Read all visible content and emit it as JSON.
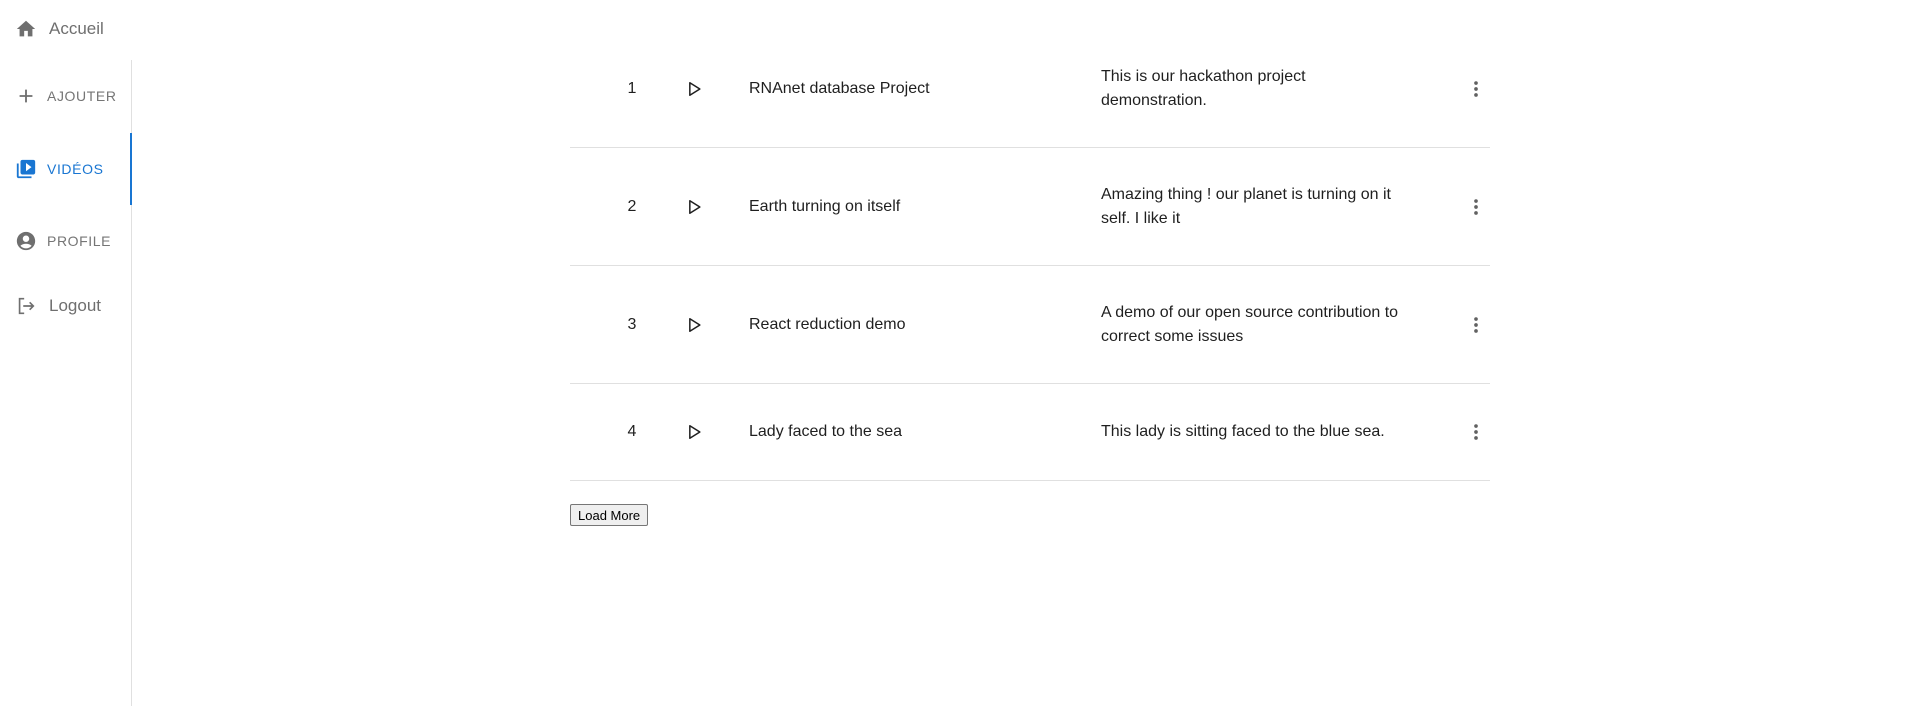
{
  "sidebar": {
    "items": [
      {
        "id": "home",
        "label": "Accueil",
        "icon": "home-icon"
      },
      {
        "id": "add",
        "label": "AJOUTER",
        "icon": "plus-icon"
      },
      {
        "id": "videos",
        "label": "VIDÉOS",
        "icon": "video-library-icon",
        "active": true
      },
      {
        "id": "profile",
        "label": "PROFILE",
        "icon": "account-circle-icon"
      },
      {
        "id": "logout",
        "label": "Logout",
        "icon": "logout-icon"
      }
    ],
    "active_color": "#1976d2",
    "inactive_color": "#757575"
  },
  "videos": {
    "rows": [
      {
        "num": "1",
        "title": "RNAnet database Project",
        "description": "This is our hackathon project demonstration."
      },
      {
        "num": "2",
        "title": "Earth turning on itself",
        "description": "Amazing thing ! our planet is turning on it self. I like it"
      },
      {
        "num": "3",
        "title": "React reduction demo",
        "description": "A demo of our open source contribution to correct some issues"
      },
      {
        "num": "4",
        "title": "Lady faced to the sea",
        "description": "This lady is sitting faced to the blue sea."
      }
    ],
    "load_more_label": "Load More"
  }
}
